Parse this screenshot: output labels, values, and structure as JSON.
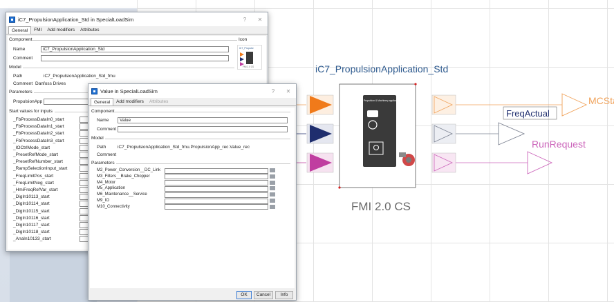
{
  "outer_dialog": {
    "title": "iC7_PropulsionApplication_Std in SpecialLoadSim",
    "help": "?",
    "close": "✕",
    "tabs": [
      "General",
      "FMI",
      "Add modifiers",
      "Attributes"
    ],
    "component_group": "Component",
    "icon_group": "Icon",
    "name_label": "Name",
    "name_value": "iC7_PropulsionApplication_Std",
    "comment_label": "Comment",
    "model_group": "Model",
    "path_label": "Path",
    "path_value": "iC7_PropulsionApplication_Std_fmu",
    "comment2_label": "Comment",
    "comment2_value": "Danfoss Drives",
    "parameters_group": "Parameters",
    "param_propulsion": "PropulsionApp",
    "start_values_group": "Start values for inputs",
    "start_values": [
      "_FbProcessDataIn0_start",
      "_FbProcessDataIn1_start",
      "_FbProcessDataIn2_start",
      "_FbProcessDataIn3_start",
      "_IOCtrlMode_start",
      "_PresetRefMode_start",
      "_PresetRefNumber_start",
      "_RampSelectionInput_start",
      "_FreqLimitPos_start",
      "_FreqLimitNeg_start",
      "_HmiFreqRefVar_start",
      "_DigIn10113_start",
      "_DigIn10114_start",
      "_DigIn10115_start",
      "_DigIn10116_start",
      "_DigIn10117_start",
      "_DigIn10118_start",
      "_AnaIn10133_start"
    ]
  },
  "inner_dialog": {
    "title": "Value in SpecialLoadSim",
    "help": "?",
    "close": "✕",
    "tabs": [
      "General",
      "Add modifiers",
      "Attributes"
    ],
    "component_group": "Component",
    "name_label": "Name",
    "name_value": "Value",
    "comment_label": "Comment",
    "model_group": "Model",
    "path_label": "Path",
    "path_value": "iC7_PropulsionApplication_Std_fmu.PropulsionApp_rec.Value_rec",
    "comment2_label": "Comment",
    "parameters_group": "Parameters",
    "parameters": [
      "M2_Power_Conversion__DC_Link",
      "M3_Filters__Brake_Chopper",
      "M4_Motor",
      "M5_Application",
      "M6_Maintenance__Service",
      "M9_IO",
      "M10_Connectivity"
    ],
    "buttons": {
      "ok": "OK",
      "cancel": "Cancel",
      "info": "Info"
    }
  },
  "diagram": {
    "block_title": "iC7_PropulsionApplication_Std",
    "block_subtitle": "FMI 2.0 CS",
    "inner_label": "Propulsion & Machinery application model",
    "outputs": [
      "MCStatus",
      "FreqActual",
      "RunRequest"
    ],
    "colors": {
      "input_orange": "#f07a1a",
      "input_navy": "#1f2e6e",
      "input_magenta": "#c03ea0",
      "output_orange": "#f0a25a",
      "output_gray": "#7a8090",
      "output_magenta": "#cc66bb",
      "title_blue": "#2f5b8f",
      "subtitle_gray": "#6a6a6a"
    }
  },
  "icon_thumb": {
    "label": "iC7_Propulsi",
    "sub": "FMI 2.0 CS"
  }
}
